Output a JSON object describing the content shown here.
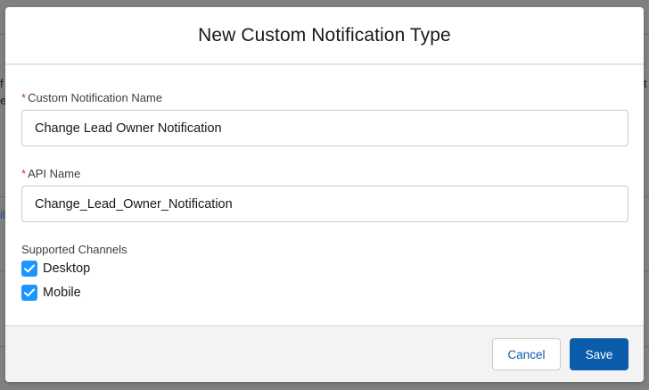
{
  "modal": {
    "title": "New Custom Notification Type",
    "fields": {
      "name": {
        "required_marker": "*",
        "label": "Custom Notification Name",
        "value": "Change Lead Owner Notification"
      },
      "api": {
        "required_marker": "*",
        "label": "API Name",
        "value": "Change_Lead_Owner_Notification"
      }
    },
    "channels": {
      "label": "Supported Channels",
      "options": [
        {
          "label": "Desktop",
          "checked": true
        },
        {
          "label": "Mobile",
          "checked": true
        }
      ]
    },
    "footer": {
      "cancel_label": "Cancel",
      "save_label": "Save"
    }
  },
  "background": {
    "fragments": [
      "f",
      "e",
      "il",
      "t"
    ]
  },
  "colors": {
    "brand": "#0b5cab",
    "checkbox": "#1b96ff",
    "required": "#c23934",
    "footer_bg": "#f3f3f3",
    "overlay": "#808080"
  },
  "icons": {
    "checkbox_check": "check-icon"
  }
}
